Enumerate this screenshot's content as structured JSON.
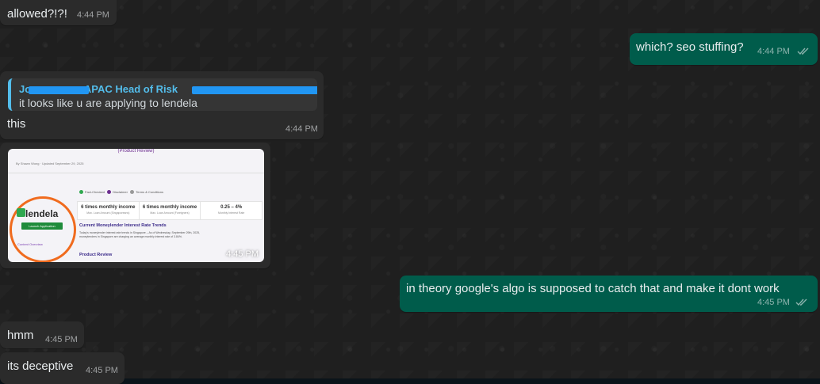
{
  "messages": [
    {
      "text": "allowed?!?!",
      "time": "4:44 PM"
    },
    {
      "text": "which? seo stuffing?",
      "time": "4:44 PM"
    },
    {
      "reply": {
        "author_visible_start": "Jo",
        "author_visible_mid": "- APAC Head of Risk",
        "text": "it looks like u are applying to lendela"
      },
      "text": "this",
      "time": "4:44 PM"
    },
    {
      "image": {
        "caption": "(Product Review)",
        "byline": "By Shawn Wong  ·  Updated September 29, 2025",
        "brand": "lendela",
        "apply_button": "Launch Application",
        "pills": [
          "Fact-Checked",
          "Disclaimer",
          "Terms & Conditions"
        ],
        "stats": [
          {
            "value": "6 times monthly income",
            "label": "Max. Loan Amount (Singaporeans)"
          },
          {
            "value": "6 times monthly income",
            "label": "Max. Loan Amount (Foreigners)"
          },
          {
            "value": "0.25 – 4%",
            "label": "Monthly Interest Rate"
          }
        ],
        "trend_title": "Current Moneylender Interest Rate Trends",
        "trend_body": "Today's moneylender interest rate trends in Singapore – As of Wednesday, September 29th, 2025, moneylenders in Singapore are charging an average monthly interest rate of 3.84%.",
        "content_overview": "Content Overview",
        "product_review": "Product Review"
      },
      "time": "4:45 PM"
    },
    {
      "text": "in theory google's algo is supposed to catch that and make it dont work",
      "time": "4:45 PM"
    },
    {
      "text": "hmm",
      "time": "4:45 PM"
    },
    {
      "text": "its deceptive",
      "time": "4:45 PM"
    }
  ],
  "colors": {
    "incoming_bubble": "#2b2b2b",
    "outgoing_bubble": "#005c4b",
    "quote_accent": "#53bdeb",
    "redaction": "#2196f3"
  }
}
